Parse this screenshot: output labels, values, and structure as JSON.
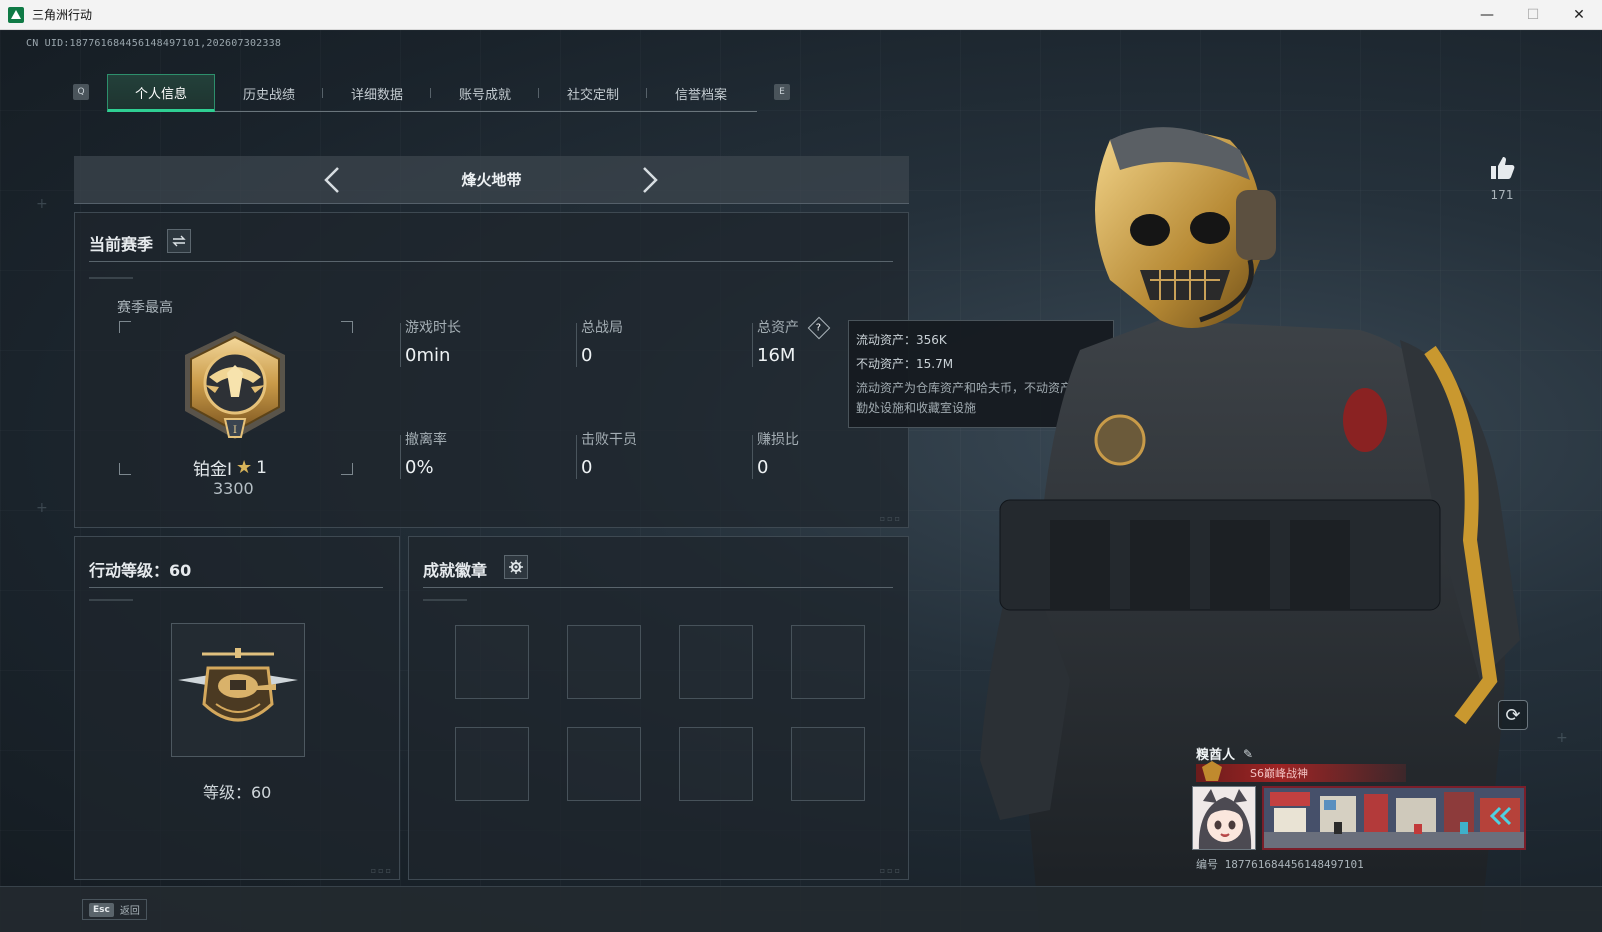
{
  "window": {
    "title": "三角洲行动",
    "controls": {
      "minimize": "—",
      "maximize": "☐",
      "close": "✕"
    }
  },
  "header": {
    "uid": "CN UID:18776168445614849​7101,202607302338"
  },
  "tabs": {
    "prev_key": "Q",
    "next_key": "E",
    "items": [
      {
        "label": "个人信息",
        "active": true
      },
      {
        "label": "历史战绩",
        "active": false
      },
      {
        "label": "详细数据",
        "active": false
      },
      {
        "label": "账号成就",
        "active": false
      },
      {
        "label": "社交定制",
        "active": false
      },
      {
        "label": "信誉档案",
        "active": false
      }
    ]
  },
  "mode": {
    "title": "烽火地带",
    "prev_icon": "chevron-left-icon",
    "next_icon": "chevron-right-icon"
  },
  "season": {
    "title": "当前赛季",
    "switch_icon": "swap-icon",
    "best_label": "赛季最高",
    "rank_name": "铂金I",
    "rank_stars": "1",
    "rank_score": "3300",
    "stats": [
      {
        "label": "游戏时长",
        "value": "0min"
      },
      {
        "label": "总战局",
        "value": "0"
      },
      {
        "label": "总资产",
        "value": "16M",
        "has_help": true
      },
      {
        "label": "撤离率",
        "value": "0%"
      },
      {
        "label": "击败干员",
        "value": "0"
      },
      {
        "label": "赚损比",
        "value": "0"
      }
    ]
  },
  "tooltip": {
    "liquid": "流动资产：356K",
    "fixed": "不动资产：15.7M",
    "description": "流动资产为仓库资产和哈夫币，不动资产为特勤处设施和收藏室设施"
  },
  "level": {
    "title": "行动等级：60",
    "caption": "等级：60"
  },
  "achievements": {
    "title": "成就徽章",
    "settings_icon": "gear-icon",
    "slot_count": 8
  },
  "profile": {
    "like_count": "171",
    "name": "糗酋人",
    "title_badge": "S6巅峰战神",
    "id_line": "编号 18776168445614849​7101"
  },
  "footer": {
    "esc_key": "Esc",
    "esc_label": "返回"
  }
}
